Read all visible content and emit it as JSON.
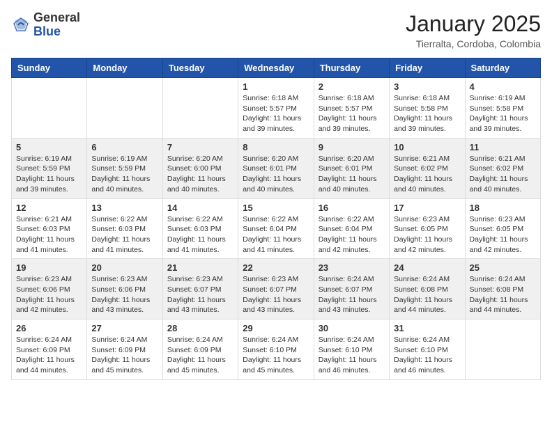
{
  "header": {
    "logo": {
      "line1": "General",
      "line2": "Blue"
    },
    "title": "January 2025",
    "location": "Tierralta, Cordoba, Colombia"
  },
  "weekdays": [
    "Sunday",
    "Monday",
    "Tuesday",
    "Wednesday",
    "Thursday",
    "Friday",
    "Saturday"
  ],
  "weeks": [
    [
      {
        "day": "",
        "info": ""
      },
      {
        "day": "",
        "info": ""
      },
      {
        "day": "",
        "info": ""
      },
      {
        "day": "1",
        "info": "Sunrise: 6:18 AM\nSunset: 5:57 PM\nDaylight: 11 hours\nand 39 minutes."
      },
      {
        "day": "2",
        "info": "Sunrise: 6:18 AM\nSunset: 5:57 PM\nDaylight: 11 hours\nand 39 minutes."
      },
      {
        "day": "3",
        "info": "Sunrise: 6:18 AM\nSunset: 5:58 PM\nDaylight: 11 hours\nand 39 minutes."
      },
      {
        "day": "4",
        "info": "Sunrise: 6:19 AM\nSunset: 5:58 PM\nDaylight: 11 hours\nand 39 minutes."
      }
    ],
    [
      {
        "day": "5",
        "info": "Sunrise: 6:19 AM\nSunset: 5:59 PM\nDaylight: 11 hours\nand 39 minutes."
      },
      {
        "day": "6",
        "info": "Sunrise: 6:19 AM\nSunset: 5:59 PM\nDaylight: 11 hours\nand 40 minutes."
      },
      {
        "day": "7",
        "info": "Sunrise: 6:20 AM\nSunset: 6:00 PM\nDaylight: 11 hours\nand 40 minutes."
      },
      {
        "day": "8",
        "info": "Sunrise: 6:20 AM\nSunset: 6:01 PM\nDaylight: 11 hours\nand 40 minutes."
      },
      {
        "day": "9",
        "info": "Sunrise: 6:20 AM\nSunset: 6:01 PM\nDaylight: 11 hours\nand 40 minutes."
      },
      {
        "day": "10",
        "info": "Sunrise: 6:21 AM\nSunset: 6:02 PM\nDaylight: 11 hours\nand 40 minutes."
      },
      {
        "day": "11",
        "info": "Sunrise: 6:21 AM\nSunset: 6:02 PM\nDaylight: 11 hours\nand 40 minutes."
      }
    ],
    [
      {
        "day": "12",
        "info": "Sunrise: 6:21 AM\nSunset: 6:03 PM\nDaylight: 11 hours\nand 41 minutes."
      },
      {
        "day": "13",
        "info": "Sunrise: 6:22 AM\nSunset: 6:03 PM\nDaylight: 11 hours\nand 41 minutes."
      },
      {
        "day": "14",
        "info": "Sunrise: 6:22 AM\nSunset: 6:03 PM\nDaylight: 11 hours\nand 41 minutes."
      },
      {
        "day": "15",
        "info": "Sunrise: 6:22 AM\nSunset: 6:04 PM\nDaylight: 11 hours\nand 41 minutes."
      },
      {
        "day": "16",
        "info": "Sunrise: 6:22 AM\nSunset: 6:04 PM\nDaylight: 11 hours\nand 42 minutes."
      },
      {
        "day": "17",
        "info": "Sunrise: 6:23 AM\nSunset: 6:05 PM\nDaylight: 11 hours\nand 42 minutes."
      },
      {
        "day": "18",
        "info": "Sunrise: 6:23 AM\nSunset: 6:05 PM\nDaylight: 11 hours\nand 42 minutes."
      }
    ],
    [
      {
        "day": "19",
        "info": "Sunrise: 6:23 AM\nSunset: 6:06 PM\nDaylight: 11 hours\nand 42 minutes."
      },
      {
        "day": "20",
        "info": "Sunrise: 6:23 AM\nSunset: 6:06 PM\nDaylight: 11 hours\nand 43 minutes."
      },
      {
        "day": "21",
        "info": "Sunrise: 6:23 AM\nSunset: 6:07 PM\nDaylight: 11 hours\nand 43 minutes."
      },
      {
        "day": "22",
        "info": "Sunrise: 6:23 AM\nSunset: 6:07 PM\nDaylight: 11 hours\nand 43 minutes."
      },
      {
        "day": "23",
        "info": "Sunrise: 6:24 AM\nSunset: 6:07 PM\nDaylight: 11 hours\nand 43 minutes."
      },
      {
        "day": "24",
        "info": "Sunrise: 6:24 AM\nSunset: 6:08 PM\nDaylight: 11 hours\nand 44 minutes."
      },
      {
        "day": "25",
        "info": "Sunrise: 6:24 AM\nSunset: 6:08 PM\nDaylight: 11 hours\nand 44 minutes."
      }
    ],
    [
      {
        "day": "26",
        "info": "Sunrise: 6:24 AM\nSunset: 6:09 PM\nDaylight: 11 hours\nand 44 minutes."
      },
      {
        "day": "27",
        "info": "Sunrise: 6:24 AM\nSunset: 6:09 PM\nDaylight: 11 hours\nand 45 minutes."
      },
      {
        "day": "28",
        "info": "Sunrise: 6:24 AM\nSunset: 6:09 PM\nDaylight: 11 hours\nand 45 minutes."
      },
      {
        "day": "29",
        "info": "Sunrise: 6:24 AM\nSunset: 6:10 PM\nDaylight: 11 hours\nand 45 minutes."
      },
      {
        "day": "30",
        "info": "Sunrise: 6:24 AM\nSunset: 6:10 PM\nDaylight: 11 hours\nand 46 minutes."
      },
      {
        "day": "31",
        "info": "Sunrise: 6:24 AM\nSunset: 6:10 PM\nDaylight: 11 hours\nand 46 minutes."
      },
      {
        "day": "",
        "info": ""
      }
    ]
  ]
}
